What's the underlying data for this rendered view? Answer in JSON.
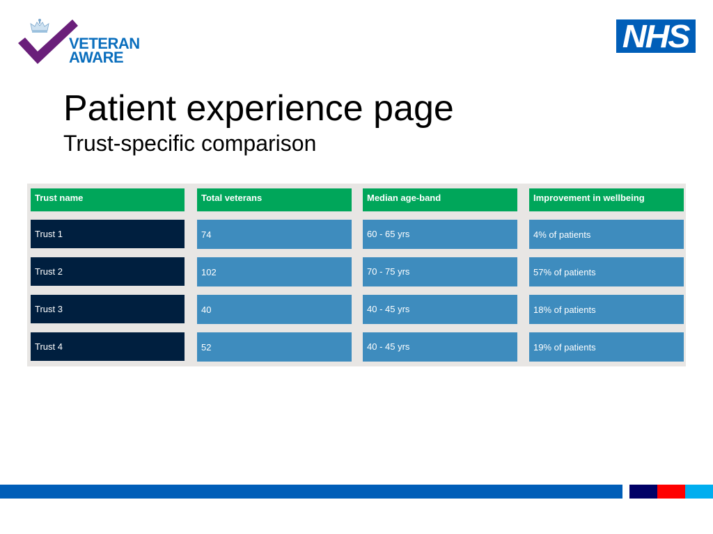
{
  "logos": {
    "veteran_aware": {
      "line1": "VETERAN",
      "line2": "AWARE",
      "check_color": "#6a1f7a",
      "text_color": "#0a6ebd"
    },
    "nhs": {
      "text": "NHS",
      "background": "#005eb8"
    }
  },
  "header": {
    "title": "Patient experience page",
    "subtitle": "Trust-specific comparison"
  },
  "table": {
    "columns": [
      "Trust name",
      "Total veterans",
      "Median age-band",
      "Improvement in wellbeing"
    ],
    "rows": [
      {
        "trust": "Trust 1",
        "total_veterans": "74",
        "median_age_band": "60 - 65 yrs",
        "improvement": "4% of patients"
      },
      {
        "trust": "Trust 2",
        "total_veterans": "102",
        "median_age_band": "70 - 75 yrs",
        "improvement": "57% of patients"
      },
      {
        "trust": "Trust 3",
        "total_veterans": "40",
        "median_age_band": "40 - 45 yrs",
        "improvement": "18% of patients"
      },
      {
        "trust": "Trust 4",
        "total_veterans": "52",
        "median_age_band": "40 - 45 yrs",
        "improvement": "19% of patients"
      }
    ],
    "colors": {
      "header": "#00a65a",
      "trust_name_cell": "#001f3f",
      "value_cell": "#3e8cbe",
      "panel": "#e8e6e4"
    }
  },
  "footer": {
    "bar_color": "#005eb8",
    "swatches": [
      "#000066",
      "#ff0000",
      "#00aeef"
    ]
  }
}
